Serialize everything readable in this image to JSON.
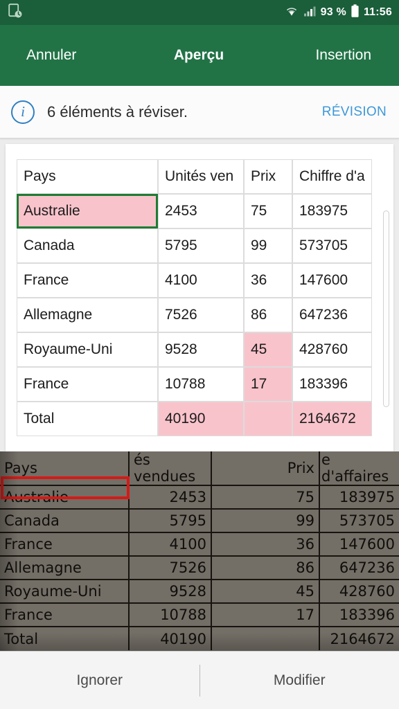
{
  "statusbar": {
    "left_icon": "recent-document-icon",
    "wifi_icon": "wifi-icon",
    "signal_icon": "cellular-signal-icon",
    "battery_icon": "battery-icon",
    "battery_text": "93 %",
    "clock": "11:56"
  },
  "appbar": {
    "cancel_label": "Annuler",
    "title": "Aperçu",
    "insert_label": "Insertion",
    "bg_color": "#217346"
  },
  "banner": {
    "info_icon": "info-icon",
    "message": "6 éléments à réviser.",
    "action_label": "RÉVISION",
    "action_color": "#3d98d8"
  },
  "preview": {
    "columns": [
      "Pays",
      "Unités ven",
      "Prix",
      "Chiffre d'a"
    ],
    "rows": [
      {
        "cells": [
          "Australie",
          "2453",
          "75",
          "183975"
        ],
        "flags": [
          false,
          false,
          false,
          false
        ],
        "selected": 0
      },
      {
        "cells": [
          "Canada",
          "5795",
          "99",
          "573705"
        ],
        "flags": [
          false,
          false,
          false,
          false
        ],
        "selected": -1
      },
      {
        "cells": [
          "France",
          "4100",
          "36",
          "147600"
        ],
        "flags": [
          false,
          false,
          false,
          false
        ],
        "selected": -1
      },
      {
        "cells": [
          "Allemagne",
          "7526",
          "86",
          "647236"
        ],
        "flags": [
          false,
          false,
          false,
          false
        ],
        "selected": -1
      },
      {
        "cells": [
          "Royaume-Uni",
          "9528",
          "45",
          "428760"
        ],
        "flags": [
          false,
          false,
          true,
          false
        ],
        "selected": -1
      },
      {
        "cells": [
          "France",
          "10788",
          "17",
          "183396"
        ],
        "flags": [
          false,
          false,
          true,
          false
        ],
        "selected": -1
      },
      {
        "cells": [
          "Total",
          "40190",
          "",
          "2164672"
        ],
        "flags": [
          false,
          true,
          true,
          true
        ],
        "selected": -1
      }
    ],
    "selection_border_color": "#1e7b34",
    "flag_fill_color": "#f9c3cb"
  },
  "photo": {
    "columns": [
      "Pays",
      "és vendues",
      "Prix",
      "e d'affaires"
    ],
    "rows": [
      [
        "Australie",
        "2453",
        "75",
        "183975"
      ],
      [
        "Canada",
        "5795",
        "99",
        "573705"
      ],
      [
        "France",
        "4100",
        "36",
        "147600"
      ],
      [
        "Allemagne",
        "7526",
        "86",
        "647236"
      ],
      [
        "Royaume-Uni",
        "9528",
        "45",
        "428760"
      ],
      [
        "France",
        "10788",
        "17",
        "183396"
      ],
      [
        "Total",
        "40190",
        "",
        "2164672"
      ]
    ],
    "highlight_row": 0,
    "highlight_color": "#d41a17"
  },
  "bottombar": {
    "ignore_label": "Ignorer",
    "edit_label": "Modifier"
  }
}
